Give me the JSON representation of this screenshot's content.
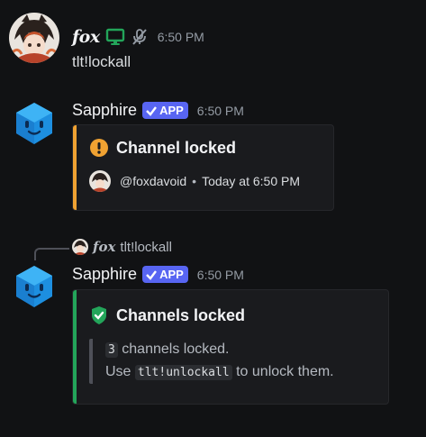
{
  "colors": {
    "background": "#111214",
    "embed_bg": "#1a1b1e",
    "warning_bar": "#f0a232",
    "success_bar": "#23a55a",
    "app_badge": "#5865f2",
    "desktop_icon": "#23a55a"
  },
  "messages": [
    {
      "username": "fox",
      "timestamp": "6:50 PM",
      "content": "tlt!lockall",
      "icons": [
        "desktop-icon",
        "muted-mic-icon"
      ]
    },
    {
      "username": "Sapphire",
      "badge": "APP",
      "timestamp": "6:50 PM",
      "embed": {
        "title": "Channel locked",
        "title_icon": "warning-icon",
        "footer_author": "@foxdavoid",
        "footer_separator": "•",
        "footer_time": "Today at 6:50 PM"
      }
    },
    {
      "reply": {
        "username": "fox",
        "content": "tlt!lockall"
      },
      "username": "Sapphire",
      "badge": "APP",
      "timestamp": "6:50 PM",
      "embed": {
        "title": "Channels locked",
        "title_icon": "check-icon",
        "line1_code": "3",
        "line1_text": "channels locked.",
        "line2_pre": "Use",
        "line2_code": "tlt!unlockall",
        "line2_post": "to unlock them."
      }
    }
  ]
}
